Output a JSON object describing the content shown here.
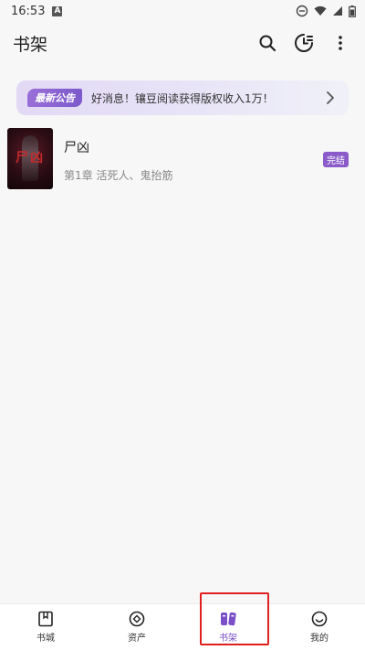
{
  "status_bar": {
    "time": "16:53",
    "notification_glyph": "A"
  },
  "app_bar": {
    "title": "书架"
  },
  "announcement": {
    "badge": "最新公告",
    "text": "好消息！镶豆阅读获得版权收入1万！"
  },
  "books": [
    {
      "title": "尸凶",
      "cover_text": "尸凶",
      "chapter": "第1章 活死人、鬼抬筋",
      "status": "完结"
    }
  ],
  "bottom_nav": {
    "items": [
      {
        "label": "书城",
        "icon": "book-icon"
      },
      {
        "label": "资产",
        "icon": "asset-icon"
      },
      {
        "label": "书架",
        "icon": "bookshelf-icon",
        "active": true
      },
      {
        "label": "我的",
        "icon": "smile-icon"
      }
    ]
  },
  "colors": {
    "accent": "#7a4fc8",
    "status_badge": "#8b5cc9",
    "highlight": "#e02020"
  }
}
